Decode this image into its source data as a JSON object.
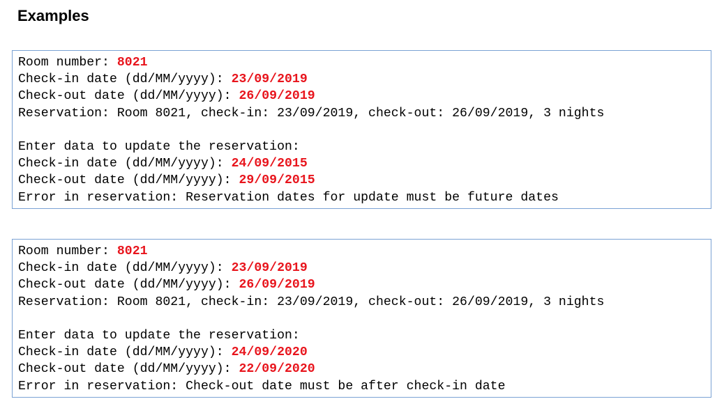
{
  "page_title": "Examples",
  "examples": [
    {
      "lines": [
        {
          "prompt": "Room number: ",
          "input": "8021"
        },
        {
          "prompt": "Check-in date (dd/MM/yyyy): ",
          "input": "23/09/2019"
        },
        {
          "prompt": "Check-out date (dd/MM/yyyy): ",
          "input": "26/09/2019"
        },
        {
          "prompt": "Reservation: Room 8021, check-in: 23/09/2019, check-out: 26/09/2019, 3 nights",
          "input": ""
        },
        {
          "prompt": "",
          "input": ""
        },
        {
          "prompt": "Enter data to update the reservation:",
          "input": ""
        },
        {
          "prompt": "Check-in date (dd/MM/yyyy): ",
          "input": "24/09/2015"
        },
        {
          "prompt": "Check-out date (dd/MM/yyyy): ",
          "input": "29/09/2015"
        },
        {
          "prompt": "Error in reservation: Reservation dates for update must be future dates",
          "input": ""
        }
      ]
    },
    {
      "lines": [
        {
          "prompt": "Room number: ",
          "input": "8021"
        },
        {
          "prompt": "Check-in date (dd/MM/yyyy): ",
          "input": "23/09/2019"
        },
        {
          "prompt": "Check-out date (dd/MM/yyyy): ",
          "input": "26/09/2019"
        },
        {
          "prompt": "Reservation: Room 8021, check-in: 23/09/2019, check-out: 26/09/2019, 3 nights",
          "input": ""
        },
        {
          "prompt": "",
          "input": ""
        },
        {
          "prompt": "Enter data to update the reservation:",
          "input": ""
        },
        {
          "prompt": "Check-in date (dd/MM/yyyy): ",
          "input": "24/09/2020"
        },
        {
          "prompt": "Check-out date (dd/MM/yyyy): ",
          "input": "22/09/2020"
        },
        {
          "prompt": "Error in reservation: Check-out date must be after check-in date",
          "input": ""
        }
      ]
    }
  ],
  "colors": {
    "input_text": "#e8141c",
    "console_border": "#7aa2d4"
  }
}
